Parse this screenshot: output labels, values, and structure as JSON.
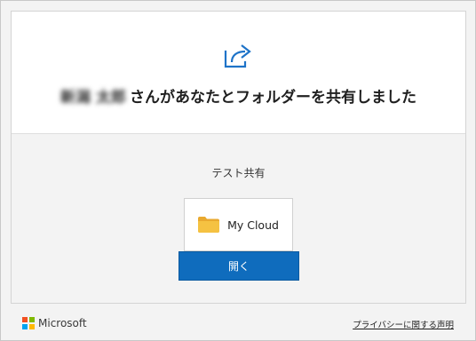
{
  "header": {
    "sender_name": "新潟 太郎",
    "message": "さんがあなたとフォルダーを共有しました"
  },
  "folder": {
    "title": "テスト共有",
    "name": "My Cloud",
    "open_label": "開く"
  },
  "footer": {
    "brand": "Microsoft",
    "privacy_link": "プライバシーに関する声明"
  },
  "colors": {
    "accent": "#0f6cbd",
    "share_icon": "#1e73c8",
    "folder": "#f5c242"
  },
  "icons": {
    "share": "share-arrow-icon",
    "folder": "folder-icon",
    "logo": "microsoft-logo-icon"
  }
}
